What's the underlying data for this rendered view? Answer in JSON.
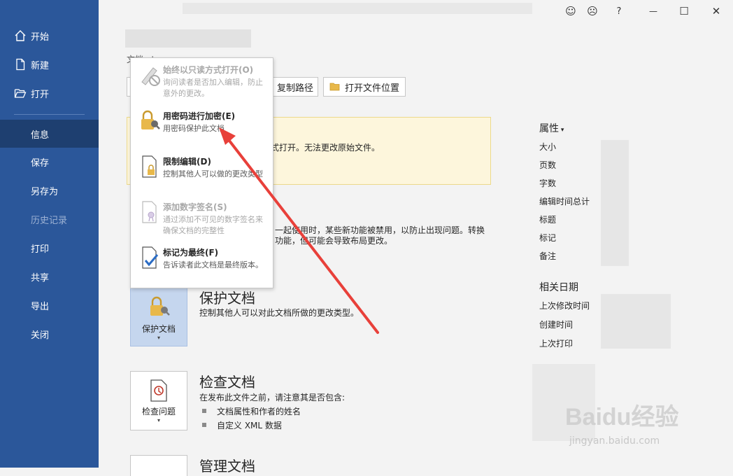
{
  "sidebar": {
    "items": [
      {
        "label": "开始",
        "icon": "home-icon"
      },
      {
        "label": "新建",
        "icon": "new-document-icon"
      },
      {
        "label": "打开",
        "icon": "open-folder-icon"
      },
      {
        "label": "信息"
      },
      {
        "label": "保存"
      },
      {
        "label": "另存为"
      },
      {
        "label": "历史记录"
      },
      {
        "label": "打印"
      },
      {
        "label": "共享"
      },
      {
        "label": "导出"
      },
      {
        "label": "关闭"
      }
    ]
  },
  "topbar": {
    "smile": "☺",
    "frown": "☹",
    "help": "?",
    "minimize": "—",
    "maximize": "☐",
    "close": "✕"
  },
  "main": {
    "path_label": "文档 · temp",
    "copy_path": "复制路径",
    "open_location": "打开文件位置",
    "warning_text": "式打开。无法更改原始文件。",
    "compat_line1": "一起使用时，某些新功能被禁用，以防止出现问题。转换",
    "compat_line2": "功能，但可能会导致布局更改。",
    "protect": {
      "tile_label": "保护文档",
      "title": "保护文档",
      "desc": "控制其他人可以对此文档所做的更改类型。"
    },
    "inspect": {
      "tile_label": "检查问题",
      "title": "检查文档",
      "desc": "在发布此文件之前，请注意其是否包含:",
      "bullets": [
        "文档属性和作者的姓名",
        "自定义 XML 数据"
      ]
    },
    "manage": {
      "title": "管理文档"
    }
  },
  "properties": {
    "header": "属性",
    "keys": [
      "大小",
      "页数",
      "字数",
      "编辑时间总计",
      "标题",
      "标记",
      "备注"
    ],
    "dates_header": "相关日期",
    "date_keys": [
      "上次修改时间",
      "创建时间",
      "上次打印"
    ]
  },
  "menu": {
    "items": [
      {
        "title": "始终以只读方式打开(O)",
        "desc": "询问读者是否加入编辑，防止意外的更改。",
        "enabled": false
      },
      {
        "title": "用密码进行加密(E)",
        "desc": "用密码保护此文档",
        "enabled": true
      },
      {
        "title": "限制编辑(D)",
        "desc": "控制其他人可以做的更改类型",
        "enabled": true
      },
      {
        "title": "添加数字签名(S)",
        "desc": "通过添加不可见的数字签名来确保文档的完整性",
        "enabled": false
      },
      {
        "title": "标记为最终(F)",
        "desc": "告诉读者此文档是最终版本。",
        "enabled": true
      }
    ]
  },
  "watermark": {
    "brand": "Baidu经验",
    "url": "jingyan.baidu.com"
  },
  "colors": {
    "sidebar": "#2b579a",
    "sidebar_active": "#1e3f70",
    "arrow": "#e8403a",
    "warning_bg": "#fdf6dc"
  }
}
